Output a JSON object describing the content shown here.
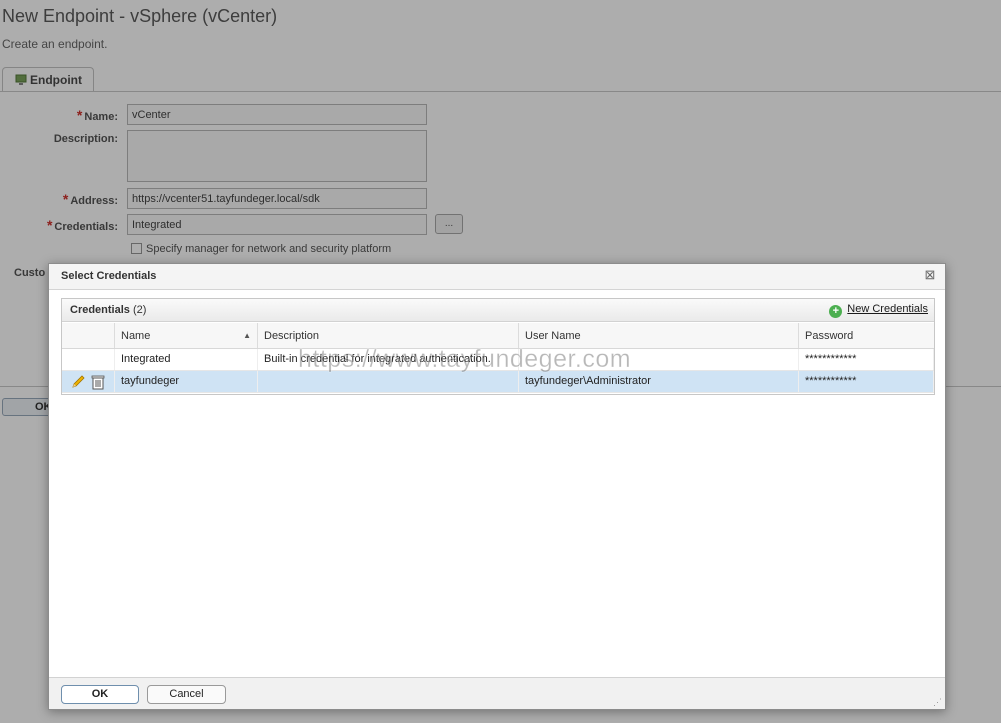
{
  "page": {
    "title": "New Endpoint - vSphere (vCenter)",
    "subtitle": "Create an endpoint.",
    "tab_label": "Endpoint",
    "customization_label": "Custo",
    "ok_label": "OK"
  },
  "form": {
    "name_label": "Name:",
    "name_value": "vCenter",
    "description_label": "Description:",
    "description_value": "",
    "address_label": "Address:",
    "address_value": "https://vcenter51.tayfundeger.local/sdk",
    "credentials_label": "Credentials:",
    "credentials_value": "Integrated",
    "browse_label": "...",
    "required_mark": "*",
    "checkbox_label": "Specify manager for network and security platform"
  },
  "dialog": {
    "title": "Select Credentials",
    "close_glyph": "⊠",
    "panel_title": "Credentials",
    "panel_count": "(2)",
    "new_credentials_label": "New Credentials",
    "columns": [
      "Name",
      "Description",
      "User Name",
      "Password"
    ],
    "sort_glyph": "▲",
    "rows": [
      {
        "name": "Integrated",
        "description": "Built-in credential for integrated authentication.",
        "user_name": "",
        "password": "************",
        "selected": false
      },
      {
        "name": "tayfundeger",
        "description": "",
        "user_name": "tayfundeger\\Administrator",
        "password": "************",
        "selected": true
      }
    ],
    "ok_label": "OK",
    "cancel_label": "Cancel",
    "grip_glyph": "⋰"
  },
  "watermark": "https://www.tayfundeger.com",
  "colors": {
    "accent": "#4caf50",
    "required": "#d0312d",
    "selected_row": "#cfe3f4"
  },
  "icons": {
    "tab": "monitor-icon",
    "edit": "pencil-icon",
    "delete": "trash-icon",
    "add": "plus-circle-icon"
  }
}
